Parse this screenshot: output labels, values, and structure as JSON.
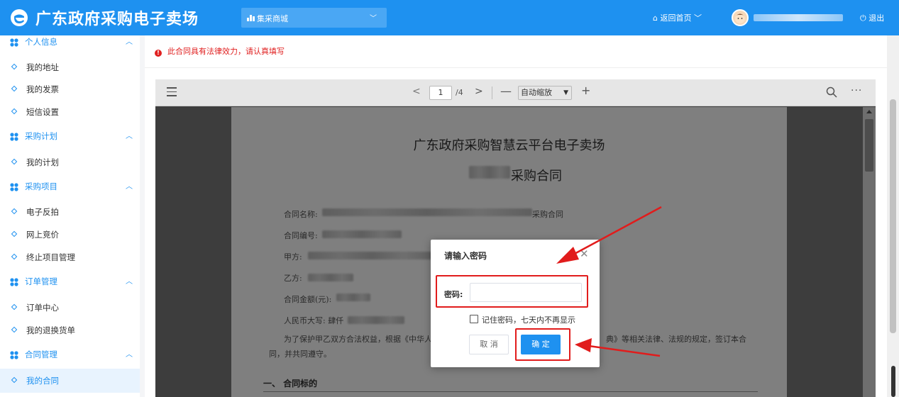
{
  "header": {
    "site_title": "广东政府采购电子卖场",
    "mall_select": "集采商城",
    "home_link": "返回首页",
    "logout": "退出"
  },
  "sidebar": {
    "groups": [
      {
        "label": "个人信息",
        "items": [
          "我的地址",
          "我的发票",
          "短信设置"
        ]
      },
      {
        "label": "采购计划",
        "items": [
          "我的计划"
        ]
      },
      {
        "label": "采购项目",
        "items": [
          "电子反拍",
          "网上竞价",
          "终止项目管理"
        ]
      },
      {
        "label": "订单管理",
        "items": [
          "订单中心",
          "我的退换货单"
        ]
      },
      {
        "label": "合同管理",
        "items": [
          "我的合同"
        ]
      }
    ]
  },
  "notice": "此合同具有法律效力，请认真填写",
  "viewer": {
    "page_current": "1",
    "page_total": "/4",
    "zoom": "自动缩放"
  },
  "document": {
    "title": "广东政府采购智慧云平台电子卖场",
    "subtitle": "采购合同",
    "field_name": "合同名称:",
    "field_name_tail": "采购合同",
    "field_number": "合同编号:",
    "field_party_a": "甲方:",
    "field_party_b": "乙方:",
    "field_amount": "合同金额(元):",
    "field_rmb": "人民币大写: 肆仟",
    "para_start": "为了保护甲乙双方合法权益，根据《中华人",
    "para_end": "典》等相关法律、法规的规定，签订本合",
    "para_line2": "同，并共同遵守。",
    "section1": "一、 合同标的"
  },
  "dialog": {
    "title": "请输入密码",
    "password_label": "密码:",
    "password_value": "",
    "remember": "记住密码，七天内不再显示",
    "cancel": "取 消",
    "confirm": "确 定"
  }
}
